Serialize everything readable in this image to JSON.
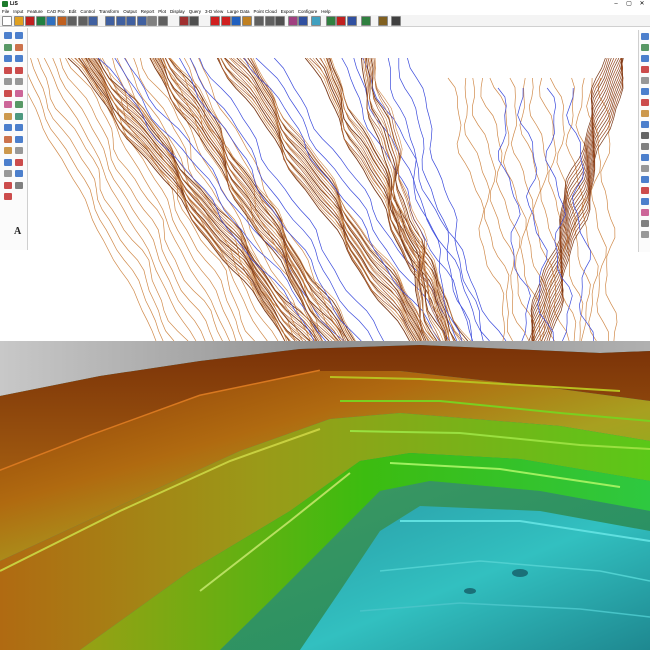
{
  "app": {
    "title": "LiS",
    "window_controls": [
      "–",
      "▢",
      "✕"
    ]
  },
  "menu": [
    "File",
    "Input",
    "Feature",
    "CAD Pro",
    "Edit",
    "Control",
    "Transform",
    "Output",
    "Report",
    "Plot",
    "Display",
    "Query",
    "3-D View",
    "Large Data",
    "Point Cloud",
    "Export",
    "Configure",
    "Help"
  ],
  "toolbar": {
    "icons": [
      "new-file-icon",
      "open-folder-icon",
      "save-icon",
      "save-green-icon",
      "globe-icon",
      "palette-icon",
      "undo-icon",
      "redo-icon",
      "zoom-in-icon",
      "zoom-out-icon",
      "zoom-window-icon",
      "zoom-extents-icon",
      "zoom-previous-icon",
      "pan-hand-icon",
      "zoom-dropdown-icon",
      "layer-icon",
      "grid-icon",
      "text-T-icon",
      "text-N-icon",
      "refresh-icon",
      "image-icon",
      "picture-icon",
      "pencil-icon",
      "ruler-icon",
      "brush-icon",
      "arrow-icon",
      "cloud-icon",
      "tin-icon",
      "eraser-icon",
      "sample-icon",
      "paint-icon",
      "person-icon",
      "car-icon"
    ]
  },
  "left_tools": {
    "icons": [
      "draw-line-icon",
      "select-icon",
      "polyline-icon",
      "arc-icon",
      "circle-icon",
      "point-icon",
      "node-icon",
      "edit-icon",
      "move-icon",
      "copy-icon",
      "delete-icon",
      "rotate-icon",
      "scale-icon",
      "trim-icon",
      "extend-icon",
      "fillet-icon",
      "offset-icon",
      "break-icon",
      "join-icon",
      "label-icon",
      "contour-icon",
      "surface-icon",
      "triangle-icon",
      "volume-icon",
      "chart-icon",
      "symbol-icon",
      "dim-icon",
      "hatch-icon",
      "measure-icon"
    ],
    "text_tool_label": "A"
  },
  "right_tools": {
    "icons": [
      "layer-manager-icon",
      "properties-icon",
      "snap-icon",
      "grid-snap-icon",
      "ortho-icon",
      "polar-icon",
      "object-snap-icon",
      "track-icon",
      "lineweight-icon",
      "model-icon",
      "text-icon",
      "zoom-icon",
      "pan-icon",
      "view-icon",
      "render-icon",
      "shade-icon",
      "light-icon",
      "camera-icon",
      "settings-icon"
    ]
  },
  "colors": {
    "contour_minor": "#d08a4a",
    "contour_major": "#7a3a1a",
    "contour_blue": "#3a4adc",
    "terrain_high": "#8a3a08",
    "terrain_mid": "#6cc41a",
    "terrain_low": "#2bb8b8"
  }
}
